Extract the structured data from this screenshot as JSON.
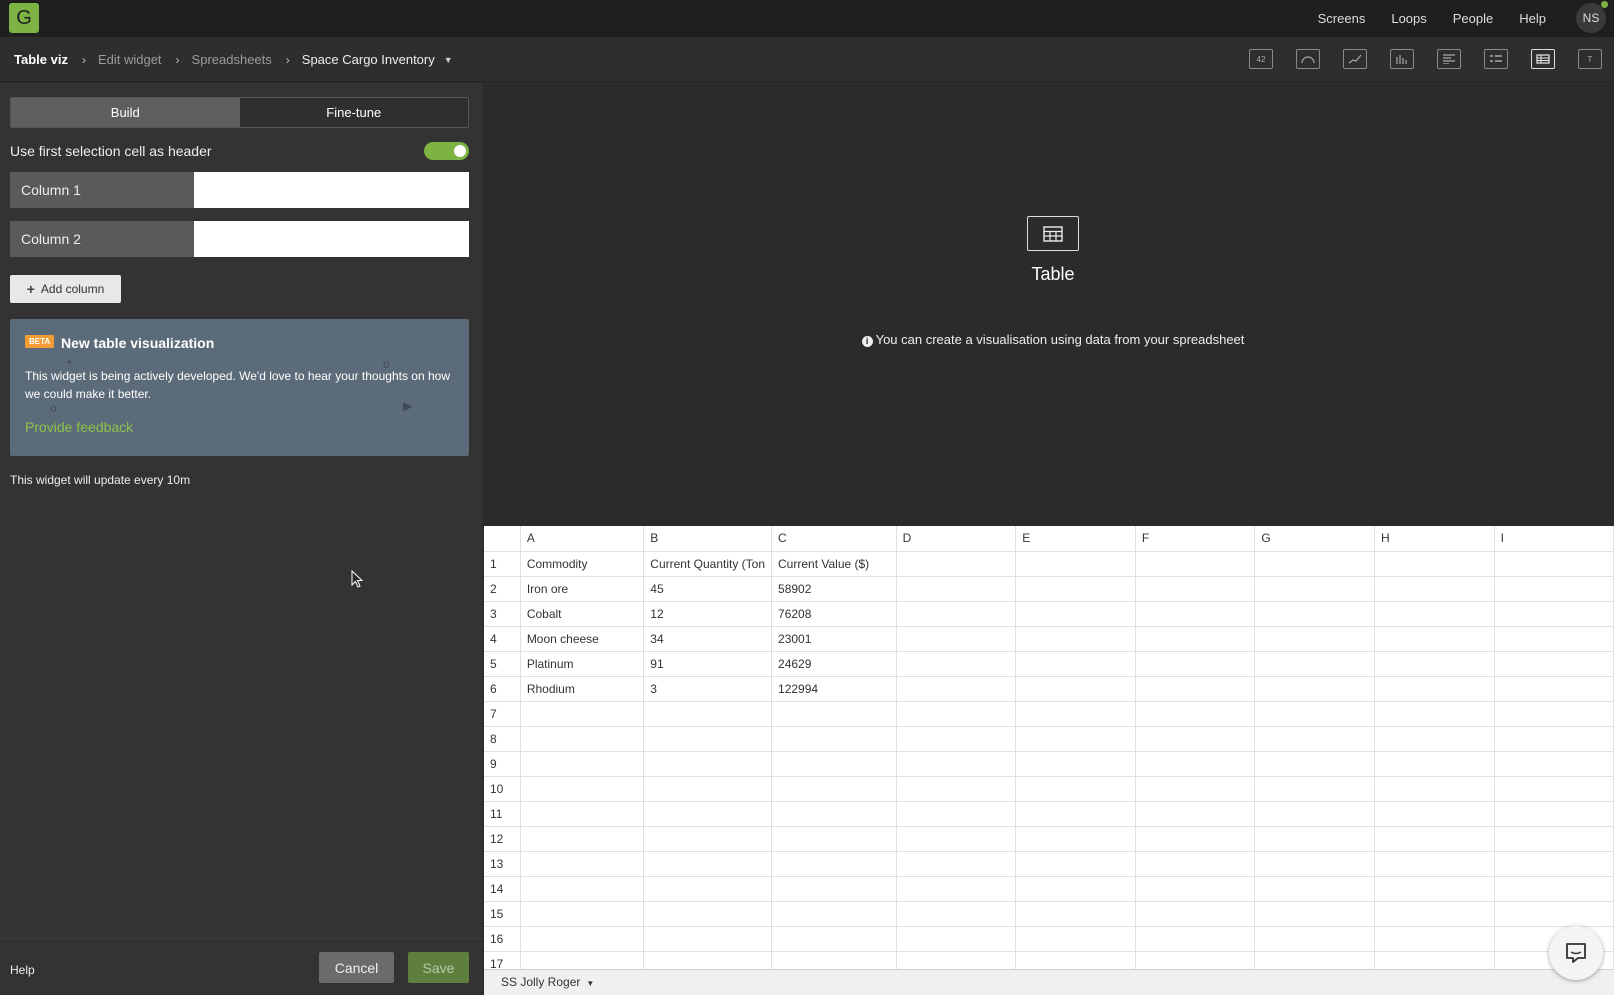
{
  "topnav": {
    "logo": "G",
    "items": [
      "Screens",
      "Loops",
      "People",
      "Help"
    ],
    "avatar": "NS"
  },
  "breadcrumb": {
    "items": [
      "Table viz",
      "Edit widget",
      "Spreadsheets",
      "Space Cargo Inventory"
    ]
  },
  "widget_types": [
    "42",
    "gauge",
    "line",
    "bar",
    "text",
    "list",
    "table",
    "T"
  ],
  "left": {
    "tabs": [
      "Build",
      "Fine-tune"
    ],
    "header_toggle_label": "Use first selection cell as header",
    "header_toggle_on": true,
    "columns": [
      {
        "label": "Column 1",
        "value": ""
      },
      {
        "label": "Column 2",
        "value": ""
      }
    ],
    "add_column": "Add column",
    "beta": {
      "badge": "BETA",
      "title": "New table visualization",
      "text": "This widget is being actively developed. We'd love to hear your thoughts on how we could make it better.",
      "link": "Provide feedback"
    },
    "update_text": "This widget will update every 10m",
    "help": "Help",
    "cancel": "Cancel",
    "save": "Save"
  },
  "preview": {
    "title": "Table",
    "info": "You can create a visualisation using data from your spreadsheet"
  },
  "sheet": {
    "columns": [
      "A",
      "B",
      "C",
      "D",
      "E",
      "F",
      "G",
      "H",
      "I"
    ],
    "rows": [
      [
        "Commodity",
        "Current Quantity (Ton",
        "Current Value ($)"
      ],
      [
        "Iron ore",
        "45",
        "58902"
      ],
      [
        "Cobalt",
        "12",
        "76208"
      ],
      [
        "Moon cheese",
        "34",
        "23001"
      ],
      [
        "Platinum",
        "91",
        "24629"
      ],
      [
        "Rhodium",
        "3",
        "122994"
      ]
    ],
    "row_count": 17,
    "tab": "SS Jolly Roger"
  },
  "colors": {
    "accent": "#7cb342",
    "beta_bg": "#5c6b79",
    "badge": "#f39c33"
  }
}
